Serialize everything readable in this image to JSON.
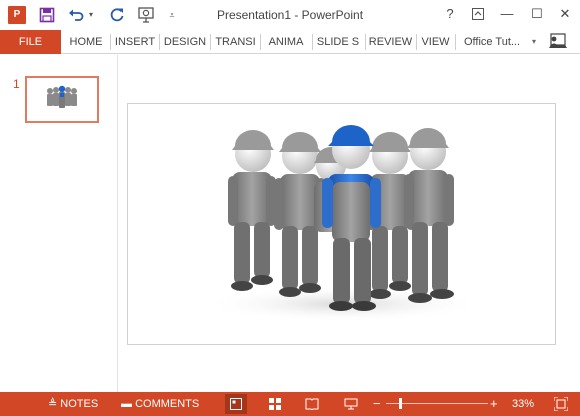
{
  "titlebar": {
    "app_logo_text": "P",
    "title": "Presentation1 - PowerPoint",
    "help": "?",
    "restore_ribbon": "⇪",
    "minimize": "—",
    "maximize": "☐",
    "close": "✕"
  },
  "quick_access": {
    "save_icon": "floppy-disk-icon",
    "undo_icon": "undo-icon",
    "redo_icon": "repeat-icon",
    "present_icon": "start-from-beginning-icon",
    "customize_icon": "customize-caret-icon"
  },
  "ribbon": {
    "file": "FILE",
    "tabs": [
      "HOME",
      "INSERT",
      "DESIGN",
      "TRANSI",
      "ANIMA",
      "SLIDE S",
      "REVIEW",
      "VIEW"
    ],
    "account": "Office Tut...",
    "account_caret": "▾"
  },
  "slides_pane": {
    "slide_number": "1"
  },
  "statusbar": {
    "notes": "NOTES",
    "comments": "COMMENTS",
    "zoom_minus": "−",
    "zoom_plus": "+",
    "zoom_level": "33%"
  },
  "colors": {
    "accent": "#d24726",
    "accent_dark": "#a6361b",
    "thumb_border": "#e07b5f",
    "figure_blue": "#1e63c8",
    "figure_gray": "#8a8a8a"
  }
}
